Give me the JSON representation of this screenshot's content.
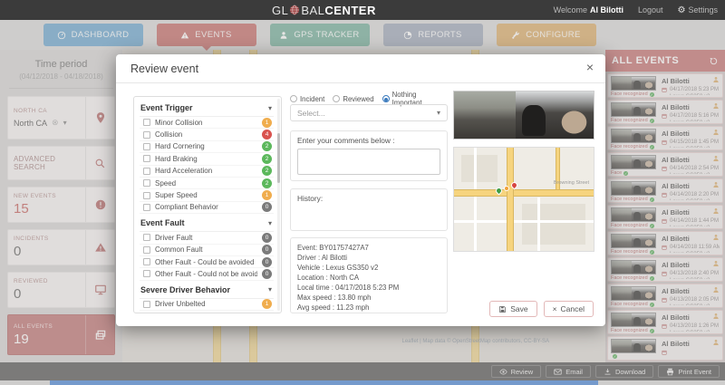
{
  "icons": {
    "chevron_down": "▾",
    "close": "×",
    "gear": "⚙",
    "clear": "⊗",
    "check": "✓"
  },
  "topbar": {
    "logo_left": "GL",
    "logo_mid": "BAL",
    "logo_bold": "CENTER",
    "welcome": "Welcome",
    "user": "Al Bilotti",
    "logout": "Logout",
    "settings": "Settings"
  },
  "nav": {
    "items": [
      {
        "label": "DASHBOARD"
      },
      {
        "label": "EVENTS"
      },
      {
        "label": "GPS TRACKER"
      },
      {
        "label": "REPORTS"
      },
      {
        "label": "CONFIGURE"
      }
    ]
  },
  "sidebar": {
    "time_period_label": "Time period",
    "time_period_range": "(04/12/2018 - 04/18/2018)",
    "region_label": "NORTH CA",
    "region_value": "North CA",
    "advanced_search_label": "ADVANCED SEARCH",
    "new_events_label": "NEW EVENTS",
    "new_events_value": "15",
    "incidents_label": "INCIDENTS",
    "incidents_value": "0",
    "reviewed_label": "REVIEWED",
    "reviewed_value": "0",
    "all_events_label": "ALL EVENTS",
    "all_events_value": "19"
  },
  "modal": {
    "title": "Review event",
    "trigger_title": "Event Trigger",
    "trigger_items": [
      {
        "label": "Minor Collision",
        "count": "1",
        "color": "orange"
      },
      {
        "label": "Collision",
        "count": "4",
        "color": "red"
      },
      {
        "label": "Hard Cornering",
        "count": "2",
        "color": "green"
      },
      {
        "label": "Hard Braking",
        "count": "2",
        "color": "green"
      },
      {
        "label": "Hard Acceleration",
        "count": "2",
        "color": "green"
      },
      {
        "label": "Speed",
        "count": "2",
        "color": "green"
      },
      {
        "label": "Super Speed",
        "count": "1",
        "color": "orange"
      },
      {
        "label": "Compliant Behavior",
        "count": "0",
        "color": "gray"
      }
    ],
    "fault_title": "Event Fault",
    "fault_items": [
      {
        "label": "Driver Fault",
        "count": "0",
        "color": "gray"
      },
      {
        "label": "Common Fault",
        "count": "0",
        "color": "gray"
      },
      {
        "label": "Other Fault - Could be avoided",
        "count": "0",
        "color": "gray"
      },
      {
        "label": "Other Fault - Could not be avoided",
        "count": "0",
        "color": "gray"
      }
    ],
    "behavior_title": "Severe Driver Behavior",
    "behavior_items": [
      {
        "label": "Driver Unbelted",
        "count": "1",
        "color": "orange"
      }
    ],
    "status_options": [
      {
        "label": "Incident",
        "state": "off"
      },
      {
        "label": "Reviewed",
        "state": "off"
      },
      {
        "label": "Nothing Important",
        "state": "on"
      }
    ],
    "select_placeholder": "Select...",
    "comments_label": "Enter your comments below :",
    "history_label": "History:",
    "details_lines": [
      {
        "text": "Event: BY01757427A7"
      },
      {
        "text": "Driver : Al Bilotti"
      },
      {
        "text": "Vehicle : Lexus GS350 v2"
      },
      {
        "text": "Location : North CA"
      },
      {
        "text": "Local time : 04/17/2018 5:23 PM"
      },
      {
        "text": "Max speed : 13.80 mph"
      },
      {
        "text": "Avg speed : 11.23 mph"
      }
    ],
    "map_street_label": "Browning Street",
    "save_label": "Save",
    "cancel_label": "Cancel"
  },
  "events_panel": {
    "title": "ALL EVENTS",
    "items": [
      {
        "name": "Al Bilotti",
        "date": "04/17/2018 5:23 PM",
        "vehicle": "Lexus GS350 v2",
        "caption": "Face recognized"
      },
      {
        "name": "Al Bilotti",
        "date": "04/17/2018 5:16 PM",
        "vehicle": "Lexus GS350 v2",
        "caption": "Face recognized"
      },
      {
        "name": "Al Bilotti",
        "date": "04/15/2018 1:45 PM",
        "vehicle": "Lexus GS350 v2",
        "caption": "Face recognized"
      },
      {
        "name": "Al Bilotti",
        "date": "04/14/2018 2:54 PM",
        "vehicle": "Lexus GS350 v2",
        "caption": "Face"
      },
      {
        "name": "Al Bilotti",
        "date": "04/14/2018 2:20 PM",
        "vehicle": "Lexus GS350 v2",
        "caption": "Face recognized"
      },
      {
        "name": "Al Bilotti",
        "date": "04/14/2018 1:44 PM",
        "vehicle": "Lexus GS350 v2",
        "caption": "Face recognized"
      },
      {
        "name": "Al Bilotti",
        "date": "04/14/2018 11:59 AM",
        "vehicle": "Lexus GS350 v2",
        "caption": "Face recognized"
      },
      {
        "name": "Al Bilotti",
        "date": "04/13/2018 2:40 PM",
        "vehicle": "Lexus GS350 v2",
        "caption": "Face recognized"
      },
      {
        "name": "Al Bilotti",
        "date": "04/13/2018 2:05 PM",
        "vehicle": "Lexus GS350 v2",
        "caption": "Face recognized"
      },
      {
        "name": "Al Bilotti",
        "date": "04/13/2018 1:26 PM",
        "vehicle": "Lexus GS350 v2",
        "caption": "Face recognized"
      },
      {
        "name": "Al Bilotti",
        "date": "",
        "vehicle": "",
        "caption": ""
      }
    ]
  },
  "footer": {
    "review": "Review",
    "email": "Email",
    "download": "Download",
    "print": "Print Event"
  },
  "map": {
    "attribution": "Leaflet | Map data © OpenStreetMap contributors, CC-BY-SA"
  },
  "colors": {
    "accent_red": "#bf605c",
    "accent_blue": "#5f9fcb",
    "accent_green": "#68a893",
    "accent_orange": "#d8a55e",
    "badge_orange": "#f0ad4e",
    "badge_red": "#d9534f",
    "badge_green": "#5cb85c",
    "badge_gray": "#7b7b7b"
  }
}
